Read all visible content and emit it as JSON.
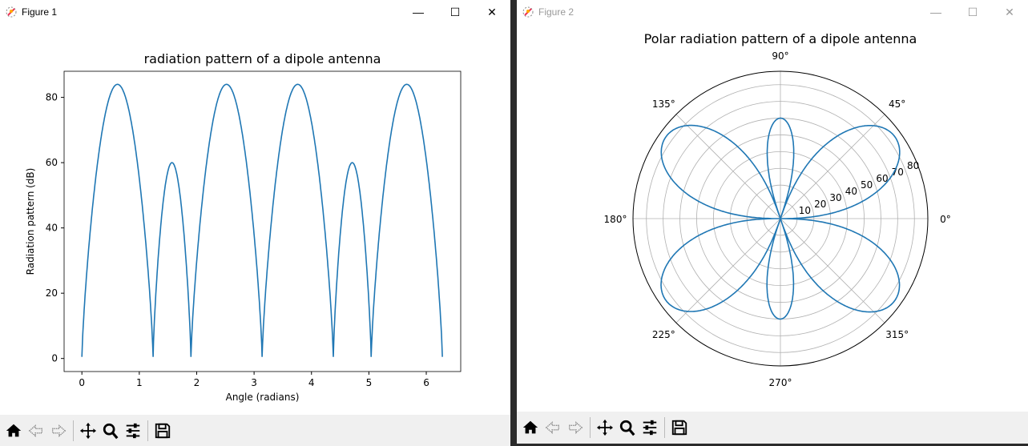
{
  "windows": [
    {
      "title": "Figure 1",
      "minimize": "—",
      "maximize": "☐",
      "close": "✕"
    },
    {
      "title": "Figure 2",
      "minimize": "—",
      "maximize": "☐",
      "close": "✕"
    }
  ],
  "toolbar": {
    "buttons": [
      "home-icon",
      "back-icon",
      "forward-icon",
      "pan-icon",
      "zoom-icon",
      "configure-icon",
      "save-icon"
    ]
  },
  "chart_data": [
    {
      "type": "line",
      "title": "radiation pattern of a dipole antenna",
      "xlabel": "Angle (radians)",
      "ylabel": "Radiation pattern (dB)",
      "xlim": [
        -0.31,
        6.6
      ],
      "ylim": [
        -4,
        88
      ],
      "xticks": [
        "0",
        "1",
        "2",
        "3",
        "4",
        "5",
        "6"
      ],
      "yticks": [
        "0",
        "20",
        "40",
        "60",
        "80"
      ],
      "color": "#1f77b4",
      "lobes": [
        {
          "start": 0,
          "end": 1.24,
          "peak": 84
        },
        {
          "start": 1.24,
          "end": 1.9,
          "peak": 60
        },
        {
          "start": 1.9,
          "end": 3.14,
          "peak": 84
        },
        {
          "start": 3.14,
          "end": 4.38,
          "peak": 84
        },
        {
          "start": 4.38,
          "end": 5.04,
          "peak": 60
        },
        {
          "start": 5.04,
          "end": 6.28,
          "peak": 84
        }
      ]
    },
    {
      "type": "polar",
      "title": "Polar radiation pattern of a dipole antenna",
      "rmax": 88,
      "angle_ticks": [
        "0°",
        "45°",
        "90°",
        "135°",
        "180°",
        "225°",
        "270°",
        "315°"
      ],
      "radial_ticks": [
        "10",
        "20",
        "30",
        "40",
        "50",
        "60",
        "70",
        "80"
      ],
      "color": "#1f77b4",
      "same_data_as": "Figure 1"
    }
  ]
}
